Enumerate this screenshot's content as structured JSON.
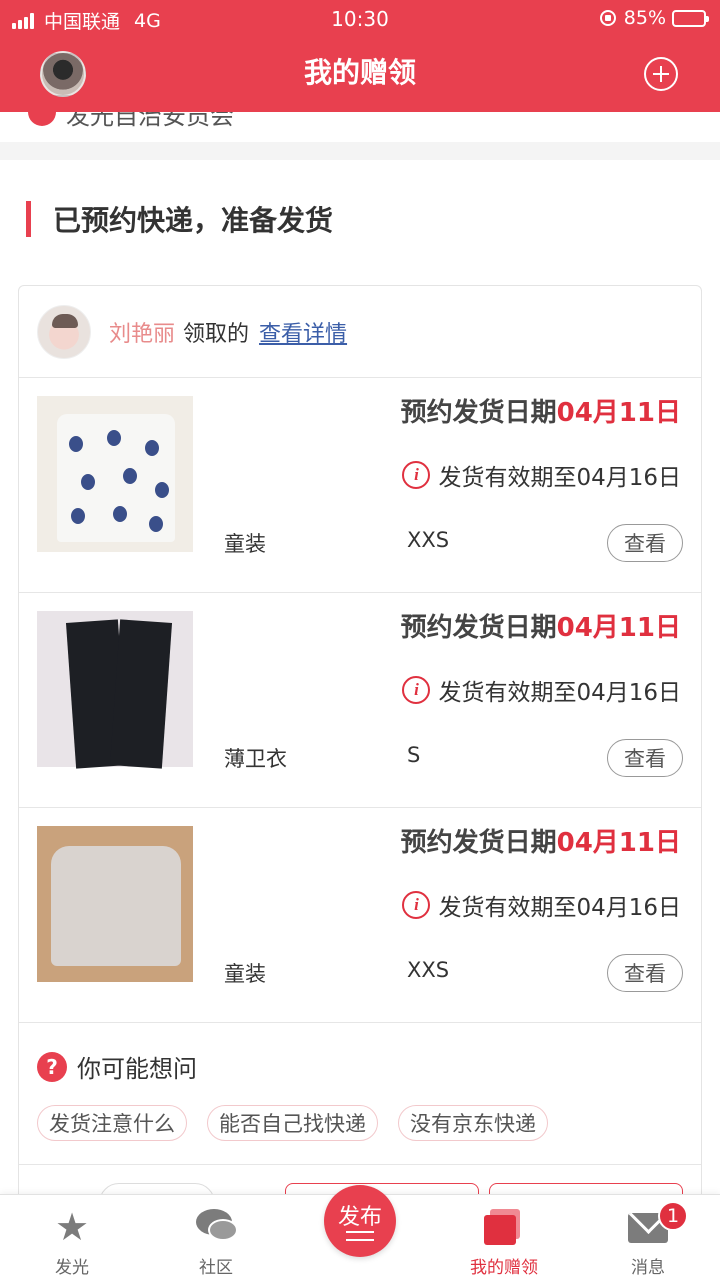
{
  "status_bar": {
    "carrier": "中国联通",
    "network": "4G",
    "time": "10:30",
    "battery": "85%"
  },
  "nav": {
    "title": "我的赠领",
    "add_icon": "plus-circle-icon"
  },
  "peek_text": "发光自治安员会",
  "section": {
    "title": "已预约快递，准备发货"
  },
  "card": {
    "user_name": "刘艳丽",
    "claimed_label": "领取的",
    "detail_link": "查看详情",
    "items": [
      {
        "date_label": "预约发货日期",
        "date": "04月11日",
        "valid_text": "发货有效期至04月16日",
        "category": "童装",
        "size": "XXS",
        "view_label": "查看"
      },
      {
        "date_label": "预约发货日期",
        "date": "04月11日",
        "valid_text": "发货有效期至04月16日",
        "category": "薄卫衣",
        "size": "S",
        "view_label": "查看"
      },
      {
        "date_label": "预约发货日期",
        "date": "04月11日",
        "valid_text": "发货有效期至04月16日",
        "category": "童装",
        "size": "XXS",
        "view_label": "查看"
      }
    ],
    "ask": {
      "title": "你可能想问",
      "chips": [
        "发货注意什么",
        "能否自己找快递",
        "没有京东快递"
      ]
    }
  },
  "tabbar": {
    "tabs": [
      {
        "label": "发光",
        "icon": "star-icon"
      },
      {
        "label": "社区",
        "icon": "chat-icon"
      },
      {
        "label": "发布",
        "icon": "publish-icon"
      },
      {
        "label": "我的赠领",
        "icon": "gift-icon"
      },
      {
        "label": "消息",
        "icon": "mail-icon",
        "badge": "1"
      }
    ]
  },
  "colors": {
    "brand": "#e8404f",
    "highlight": "#e0303f",
    "link": "#3b5ea8"
  }
}
